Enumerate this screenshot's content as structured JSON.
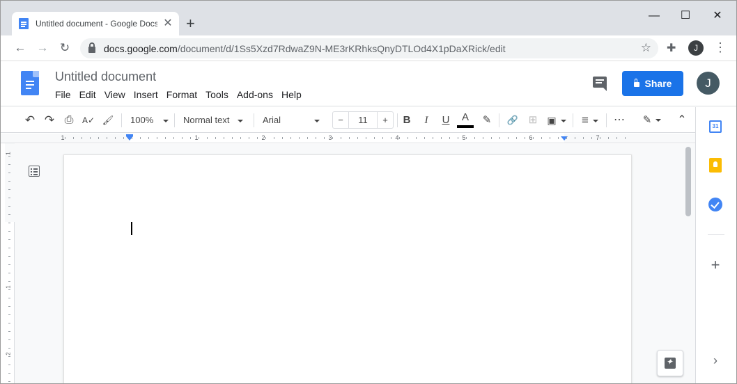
{
  "browser": {
    "tab": {
      "title": "Untitled document - Google Docs",
      "close": "✕"
    },
    "new_tab": "+",
    "window": {
      "minimize": "—",
      "maximize": "☐",
      "close": "✕"
    },
    "nav": {
      "back": "←",
      "forward": "→",
      "reload": "↻"
    },
    "url": {
      "host": "docs.google.com",
      "path": "/document/d/1Ss5Xzd7RdwaZ9N-ME3rKRhksQnyDTLOd4X1pDaXRick/edit"
    },
    "bookmark": "☆",
    "extensions": "✚",
    "profile_initial": "J",
    "menu": "⋮"
  },
  "docs": {
    "title": "Untitled document",
    "menu": [
      "File",
      "Edit",
      "View",
      "Insert",
      "Format",
      "Tools",
      "Add-ons",
      "Help"
    ],
    "share_label": "Share",
    "account_initial": "J"
  },
  "toolbar": {
    "undo": "↶",
    "redo": "↷",
    "print": "⎙",
    "spellcheck": "A✓",
    "paint_format": "🖌",
    "zoom": "100%",
    "style": "Normal text",
    "font": "Arial",
    "font_size": "11",
    "font_minus": "−",
    "font_plus": "+",
    "bold": "B",
    "italic": "I",
    "underline": "U",
    "text_color": "A",
    "highlight": "✎",
    "link": "🔗",
    "comment": "⊞",
    "image": "▣",
    "align": "≡",
    "more": "⋯",
    "editing": "✎",
    "collapse": "⌃"
  },
  "ruler": {
    "h_numbers": [
      "1",
      "1",
      "2",
      "3",
      "4",
      "5",
      "6",
      "7"
    ],
    "v_numbers": [
      "1",
      "1",
      "2"
    ]
  },
  "side_panel": {
    "calendar_day": "31",
    "add": "+",
    "expand": "›"
  },
  "colors": {
    "accent": "#1a73e8",
    "docs_blue": "#4285f4",
    "keep_yellow": "#fbbc04"
  }
}
